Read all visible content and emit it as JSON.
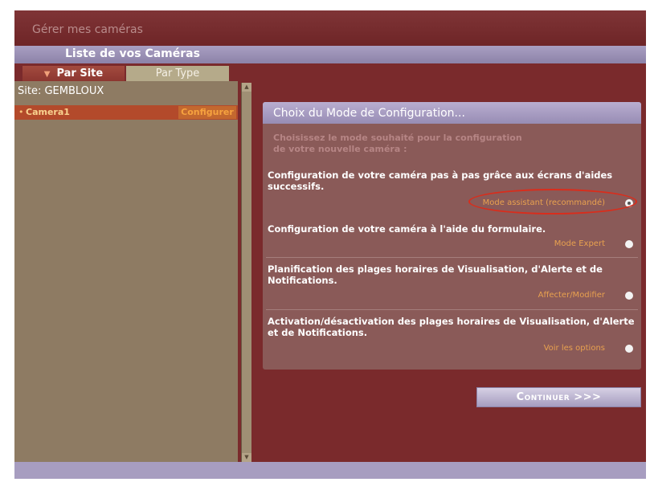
{
  "window": {
    "title": "Gérer mes caméras"
  },
  "camera_list": {
    "header": "Liste de vos Caméras",
    "tabs": [
      {
        "label": "Par Site",
        "active": true
      },
      {
        "label": "Par Type",
        "active": false
      }
    ],
    "site_label": "Site: GEMBLOUX",
    "cameras": [
      {
        "name": "Camera1",
        "action": "Configurer"
      }
    ]
  },
  "mode_panel": {
    "title": "Choix du Mode de Configuration...",
    "intro": "Choisissez le mode souhaité pour la configuration\nde votre nouvelle caméra :",
    "options": [
      {
        "description": "Configuration de votre caméra pas à pas grâce aux écrans d'aides successifs.",
        "label": "Mode assistant (recommandé)",
        "selected": true
      },
      {
        "description": "Configuration de votre caméra à l'aide du formulaire.",
        "label": "Mode Expert",
        "selected": false
      },
      {
        "description": "Planification des plages horaires de Visualisation, d'Alerte et de Notifications.",
        "label": "Affecter/Modifier",
        "selected": false
      },
      {
        "description": "Activation/désactivation des plages horaires de Visualisation, d'Alerte et de Notifications.",
        "label": "Voir les options",
        "selected": false
      }
    ]
  },
  "actions": {
    "continue_label": "Continuer >>>"
  },
  "colors": {
    "background": "#7a2a2c",
    "panel": "#8a5a58",
    "header_lavender": "#a99fc2",
    "left_panel": "#8e7b63",
    "camera_row": "#b34a2b",
    "option_label": "#e8a14f",
    "highlight": "#d92d1c"
  }
}
